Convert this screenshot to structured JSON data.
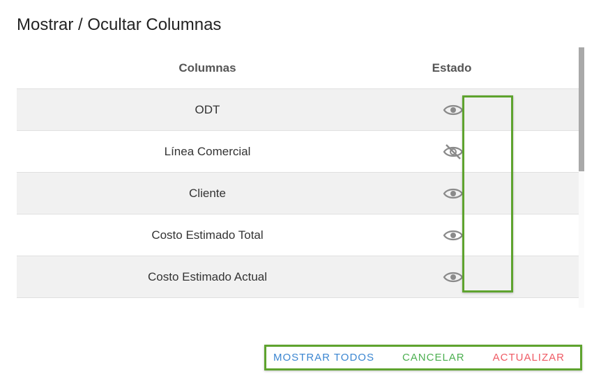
{
  "dialog": {
    "title": "Mostrar / Ocultar Columnas"
  },
  "table": {
    "headers": {
      "columns": "Columnas",
      "state": "Estado"
    },
    "rows": [
      {
        "label": "ODT",
        "visible": true,
        "icon": "eye-icon"
      },
      {
        "label": "Línea Comercial",
        "visible": false,
        "icon": "eye-off-icon"
      },
      {
        "label": "Cliente",
        "visible": true,
        "icon": "eye-icon"
      },
      {
        "label": "Costo Estimado Total",
        "visible": true,
        "icon": "eye-icon"
      },
      {
        "label": "Costo Estimado Actual",
        "visible": true,
        "icon": "eye-icon"
      }
    ]
  },
  "actions": {
    "show_all": "MOSTRAR TODOS",
    "cancel": "CANCELAR",
    "update": "ACTUALIZAR"
  },
  "colors": {
    "show_all": "#3b86d1",
    "cancel": "#4caf50",
    "update": "#ef5a64",
    "highlight": "#5ea32e",
    "icon": "#8a8a8a"
  }
}
